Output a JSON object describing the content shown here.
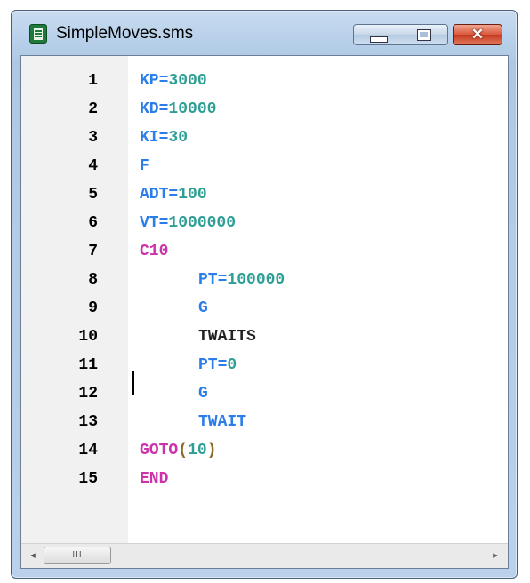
{
  "window": {
    "title": "SimpleMoves.sms",
    "icon": "notepad-document-icon",
    "controls": {
      "minimize": "▭",
      "maximize": "▢",
      "close": "✕"
    }
  },
  "editor": {
    "colors": {
      "keyword": "#2b7de9",
      "number": "#2e9f94",
      "control": "#cc33aa",
      "bracket": "#8c6a2a",
      "plain": "#222222"
    },
    "lines": [
      {
        "num": "1",
        "parts": [
          [
            "KP",
            "kw"
          ],
          [
            "=",
            "kw"
          ],
          [
            "3000",
            "num"
          ]
        ]
      },
      {
        "num": "2",
        "parts": [
          [
            "KD",
            "kw"
          ],
          [
            "=",
            "kw"
          ],
          [
            "10000",
            "num"
          ]
        ]
      },
      {
        "num": "3",
        "parts": [
          [
            "KI",
            "kw"
          ],
          [
            "=",
            "kw"
          ],
          [
            "30",
            "num"
          ]
        ]
      },
      {
        "num": "4",
        "parts": [
          [
            "F",
            "kw"
          ]
        ]
      },
      {
        "num": "5",
        "parts": [
          [
            "ADT",
            "kw"
          ],
          [
            "=",
            "kw"
          ],
          [
            "100",
            "num"
          ]
        ]
      },
      {
        "num": "6",
        "parts": [
          [
            "VT",
            "kw"
          ],
          [
            "=",
            "kw"
          ],
          [
            "1000000",
            "num"
          ]
        ]
      },
      {
        "num": "7",
        "parts": [
          [
            "C10",
            "ctl"
          ]
        ]
      },
      {
        "num": "8",
        "indent": 1,
        "parts": [
          [
            "PT",
            "kw"
          ],
          [
            "=",
            "kw"
          ],
          [
            "100000",
            "num"
          ]
        ]
      },
      {
        "num": "9",
        "indent": 1,
        "parts": [
          [
            "G",
            "kw"
          ]
        ]
      },
      {
        "num": "10",
        "indent": 1,
        "parts": [
          [
            "TWAITS",
            "plain"
          ]
        ]
      },
      {
        "num": "11",
        "indent": 1,
        "parts": [
          [
            "PT",
            "kw"
          ],
          [
            "=",
            "kw"
          ],
          [
            "0",
            "num"
          ]
        ]
      },
      {
        "num": "12",
        "indent": 1,
        "parts": [
          [
            "G",
            "kw"
          ]
        ]
      },
      {
        "num": "13",
        "indent": 1,
        "parts": [
          [
            "TWAIT",
            "kw"
          ]
        ]
      },
      {
        "num": "14",
        "parts": [
          [
            "GOTO",
            "ctl"
          ],
          [
            "(",
            "br"
          ],
          [
            "10",
            "num"
          ],
          [
            ")",
            "br"
          ]
        ]
      },
      {
        "num": "15",
        "parts": [
          [
            "END",
            "ctl"
          ]
        ]
      }
    ]
  },
  "scrollbar": {
    "left_arrow": "◂",
    "grip": "III",
    "right_arrow": "▸"
  }
}
